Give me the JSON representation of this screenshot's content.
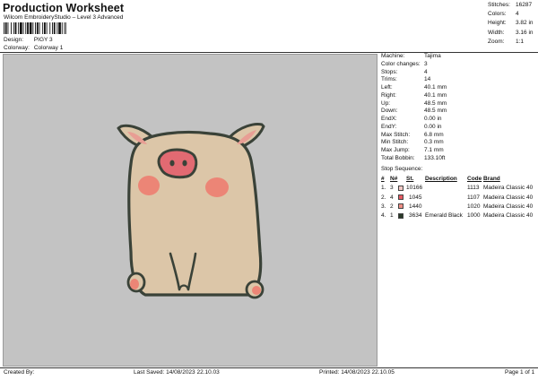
{
  "header": {
    "title": "Production Worksheet",
    "subtitle": "Wilcom EmbroideryStudio – Level 3 Advanced",
    "design_label": "Design:",
    "design_value": "PIGY 3",
    "colorway_label": "Colorway:",
    "colorway_value": "Colorway 1"
  },
  "summary": [
    {
      "label": "Stitches:",
      "value": "16287"
    },
    {
      "label": "Colors:",
      "value": "4"
    },
    {
      "label": "Height:",
      "value": "3.82 in"
    },
    {
      "label": "Width:",
      "value": "3.16 in"
    },
    {
      "label": "Zoom:",
      "value": "1:1"
    }
  ],
  "machine_info": [
    {
      "label": "Machine:",
      "value": "Tajima"
    },
    {
      "label": "Color changes:",
      "value": "3"
    },
    {
      "label": "Stops:",
      "value": "4"
    },
    {
      "label": "Trims:",
      "value": "14"
    },
    {
      "label": "Left:",
      "value": "40.1 mm"
    },
    {
      "label": "Right:",
      "value": "40.1 mm"
    },
    {
      "label": "Up:",
      "value": "48.5 mm"
    },
    {
      "label": "Down:",
      "value": "48.5 mm"
    },
    {
      "label": "EndX:",
      "value": "0.00 in"
    },
    {
      "label": "EndY:",
      "value": "0.00 in"
    },
    {
      "label": "Max Stitch:",
      "value": "6.8 mm"
    },
    {
      "label": "Min Stitch:",
      "value": "0.3 mm"
    },
    {
      "label": "Max Jump:",
      "value": "7.1 mm"
    },
    {
      "label": "Total Bobbin:",
      "value": "133.10ft"
    }
  ],
  "stop_sequence": {
    "title": "Stop Sequence:",
    "headers": {
      "num": "#",
      "n": "N#",
      "st": "St.",
      "desc": "Description",
      "code": "Code",
      "brand": "Brand"
    },
    "rows": [
      {
        "num": "1.",
        "n": "3",
        "color": "#f2c9c6",
        "st": "10166",
        "desc": "",
        "code": "1113",
        "brand": "Madeira Classic 40"
      },
      {
        "num": "2.",
        "n": "4",
        "color": "#e55a63",
        "st": "1045",
        "desc": "",
        "code": "1107",
        "brand": "Madeira Classic 40"
      },
      {
        "num": "3.",
        "n": "2",
        "color": "#ef8f86",
        "st": "1440",
        "desc": "",
        "code": "1020",
        "brand": "Madeira Classic 40"
      },
      {
        "num": "4.",
        "n": "1",
        "color": "#2b3a2a",
        "st": "3634",
        "desc": "Emerald Black",
        "code": "1000",
        "brand": "Madeira Classic 40"
      }
    ]
  },
  "footer": {
    "created_by": "Created By:",
    "last_saved": "Last Saved: 14/08/2023 22.10.03",
    "printed": "Printed: 14/08/2023 22.10.05",
    "page": "Page 1 of 1"
  },
  "colors": {
    "body_fill": "#dcc6a8",
    "outline": "#3a4238",
    "ear_pink": "#e89e94",
    "cheek": "#ec8576",
    "snout": "#e26a72",
    "preview_bg": "#c3c3c3"
  }
}
